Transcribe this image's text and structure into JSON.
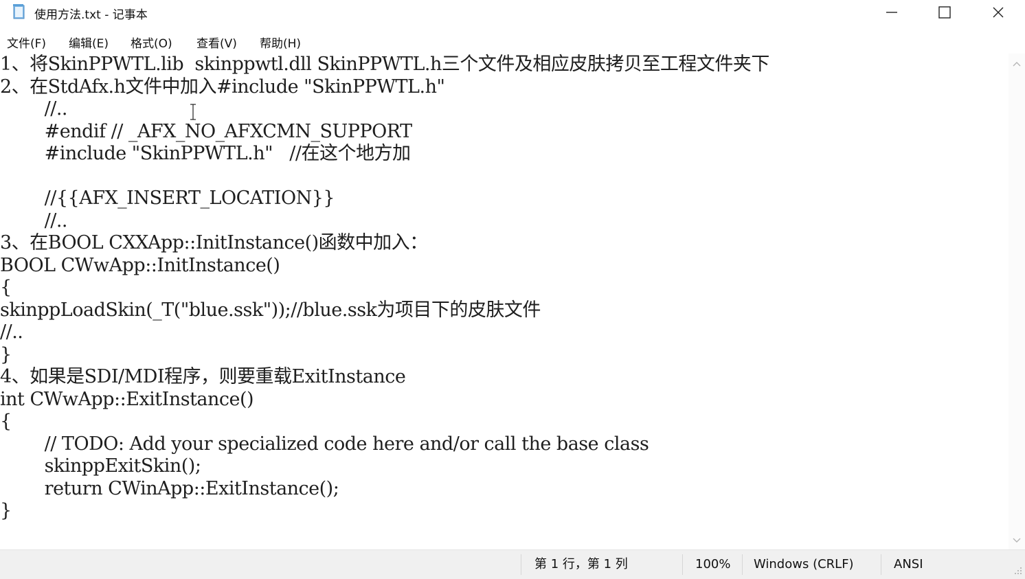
{
  "window": {
    "title": "使用方法.txt - 记事本",
    "icon": "notepad-icon",
    "controls": [
      "minimize-icon",
      "maximize-icon",
      "close-icon"
    ]
  },
  "menu": [
    "文件(F)",
    "编辑(E)",
    "格式(O)",
    "查看(V)",
    "帮助(H)"
  ],
  "editor": {
    "lines": [
      "1、将SkinPPWTL.lib  skinppwtl.dll SkinPPWTL.h三个文件及相应皮肤拷贝至工程文件夹下",
      "2、在StdAfx.h文件中加入#include \"SkinPPWTL.h\"",
      "        //..",
      "        #endif // _AFX_NO_AFXCMN_SUPPORT",
      "        #include \"SkinPPWTL.h\"   //在这个地方加",
      "",
      "        //{{AFX_INSERT_LOCATION}}",
      "        //..",
      "3、在BOOL CXXApp::InitInstance()函数中加入：",
      "BOOL CWwApp::InitInstance()",
      "{",
      "skinppLoadSkin(_T(\"blue.ssk\"));//blue.ssk为项目下的皮肤文件",
      "//..",
      "}",
      "4、如果是SDI/MDI程序，则要重载ExitInstance",
      "int CWwApp::ExitInstance()",
      "{",
      "        // TODO: Add your specialized code here and/or call the base class",
      "        skinppExitSkin();",
      "        return CWinApp::ExitInstance();",
      "}"
    ]
  },
  "status": {
    "position": "第 1 行，第 1 列",
    "zoom": "100%",
    "line_ending": "Windows (CRLF)",
    "encoding": "ANSI"
  }
}
